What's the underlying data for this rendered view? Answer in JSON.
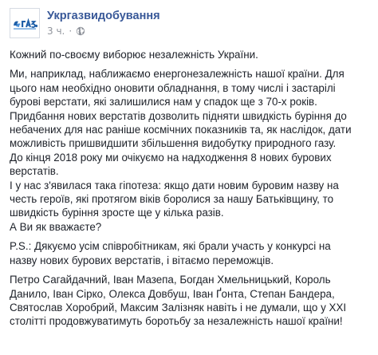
{
  "post": {
    "page_name": "Укргазвидобування",
    "timestamp": "3 ч.",
    "separator": "·",
    "privacy_icon": "globe-icon",
    "avatar_logo": "ukrgas-logo",
    "paragraphs": [
      {
        "lines": [
          "Кожний по-своєму виборює незалежність України."
        ]
      },
      {
        "lines": [
          "Ми, наприклад, наближаємо енергонезалежність нашої країни. Для",
          "цього нам необхідно оновити обладнання, в тому числі і застарілі",
          "бурові верстати, які залишилися нам у спадок ще з 70-х років.",
          "Придбання нових верстатів дозволить підняти швидкість буріння до",
          "небачених для нас раніше космічних показників та, як наслідок, дати",
          "можливість пришвидшити збільшення видобутку природного газу.",
          "До кінця 2018 року ми очікуємо на надходження 8 нових бурових",
          "верстатів.",
          "І у нас з'явилася така гіпотеза: якщо дати новим буровим назву на",
          "честь героїв, які протягом віків боролися за нашу Батьківщину, то",
          "швидкість буріння зросте ще у кілька разів.",
          "А Ви як вважаєте?"
        ]
      },
      {
        "lines": [
          "P.S.: Дякуємо усім співробітникам, які брали участь у конкурсі на",
          "назву нових бурових верстатів, і вітаємо переможців."
        ]
      },
      {
        "lines": [
          "Петро Сагайдачний, Іван Мазепа, Богдан Хмельницький, Король",
          "Данило, Іван Сірко, Олекса Довбуш, Іван Ґонта, Степан Бандера,",
          "Святослав Хоробрий, Максим Залізняк навіть і не думали, що у XXI",
          "столітті продовжуватимуть боротьбу за незалежність нашої країни!"
        ]
      }
    ]
  },
  "colors": {
    "page_name": "#385898",
    "text": "#1d2129",
    "meta": "#90949c",
    "logo_blue": "#1f5fa8"
  }
}
